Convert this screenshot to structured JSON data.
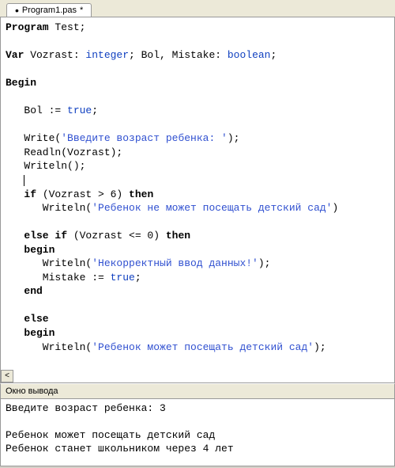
{
  "tab": {
    "modified_mark": "•",
    "filename": "Program1.pas",
    "suffix": "*"
  },
  "code": {
    "l1_a": "Program",
    "l1_b": " Test;",
    "l2": "",
    "l3_a": "Var",
    "l3_b": " Vozrast: ",
    "l3_c": "integer",
    "l3_d": "; Bol, Mistake: ",
    "l3_e": "boolean",
    "l3_f": ";",
    "l4": "",
    "l5": "Begin",
    "l6": "",
    "l7_a": "   Bol := ",
    "l7_b": "true",
    "l7_c": ";",
    "l8": "",
    "l9_a": "   Write(",
    "l9_b": "'Введите возраст ребенка: '",
    "l9_c": ");",
    "l10": "   Readln(Vozrast);",
    "l11": "   Writeln();",
    "l12": "   ",
    "l13_a": "   ",
    "l13_b": "if",
    "l13_c": " (Vozrast > 6) ",
    "l13_d": "then",
    "l14_a": "      Writeln(",
    "l14_b": "'Ребенок не может посещать детский сад'",
    "l14_c": ")",
    "l15": "",
    "l16_a": "   ",
    "l16_b": "else if",
    "l16_c": " (Vozrast <= 0) ",
    "l16_d": "then",
    "l17_a": "   ",
    "l17_b": "begin",
    "l18_a": "      Writeln(",
    "l18_b": "'Некорректный ввод данных!'",
    "l18_c": ");",
    "l19_a": "      Mistake := ",
    "l19_b": "true",
    "l19_c": ";",
    "l20_a": "   ",
    "l20_b": "end",
    "l21": "",
    "l22_a": "   ",
    "l22_b": "else",
    "l23_a": "   ",
    "l23_b": "begin",
    "l24_a": "      Writeln(",
    "l24_b": "'Ребенок может посещать детский сад'",
    "l24_c": ");"
  },
  "output_panel": {
    "title": "Окно вывода",
    "lines": {
      "l1": "Введите возраст ребенка: 3",
      "l2": "",
      "l3": "Ребенок может посещать детский сад",
      "l4": "Ребенок станет школьником через 4 лет"
    }
  },
  "scroll": {
    "left_arrow": "<"
  }
}
